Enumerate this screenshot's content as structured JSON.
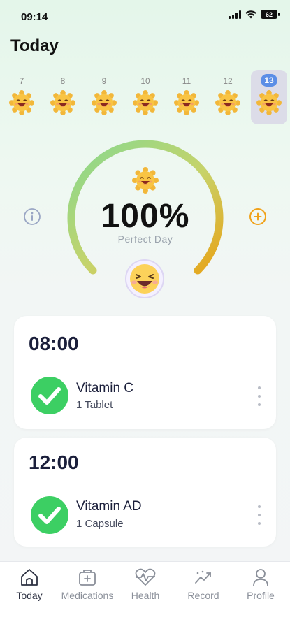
{
  "status_bar": {
    "time": "09:14",
    "battery": "62"
  },
  "page_title": "Today",
  "week": [
    {
      "day": "7",
      "selected": false
    },
    {
      "day": "8",
      "selected": false
    },
    {
      "day": "9",
      "selected": false
    },
    {
      "day": "10",
      "selected": false
    },
    {
      "day": "11",
      "selected": false
    },
    {
      "day": "12",
      "selected": false
    },
    {
      "day": "13",
      "selected": true
    }
  ],
  "progress": {
    "value_text": "100%",
    "fraction": 1.0,
    "label": "Perfect Day"
  },
  "schedules": [
    {
      "time": "08:00",
      "medication": "Vitamin C",
      "dose": "1 Tablet",
      "taken": true
    },
    {
      "time": "12:00",
      "medication": "Vitamin AD",
      "dose": "1 Capsule",
      "taken": true
    }
  ],
  "tabs": [
    {
      "label": "Today",
      "icon": "home-icon",
      "active": true
    },
    {
      "label": "Medications",
      "icon": "medicine-box-icon",
      "active": false
    },
    {
      "label": "Health",
      "icon": "heart-pulse-icon",
      "active": false
    },
    {
      "label": "Record",
      "icon": "trend-chart-icon",
      "active": false
    },
    {
      "label": "Profile",
      "icon": "person-icon",
      "active": false
    }
  ],
  "colors": {
    "gauge_start": "#86d98f",
    "gauge_end": "#e8a317",
    "check_green": "#3ccf63",
    "accent_orange": "#f0a21a",
    "selected_day": "#5b8ee6",
    "text_dark": "#1b1f3b"
  }
}
